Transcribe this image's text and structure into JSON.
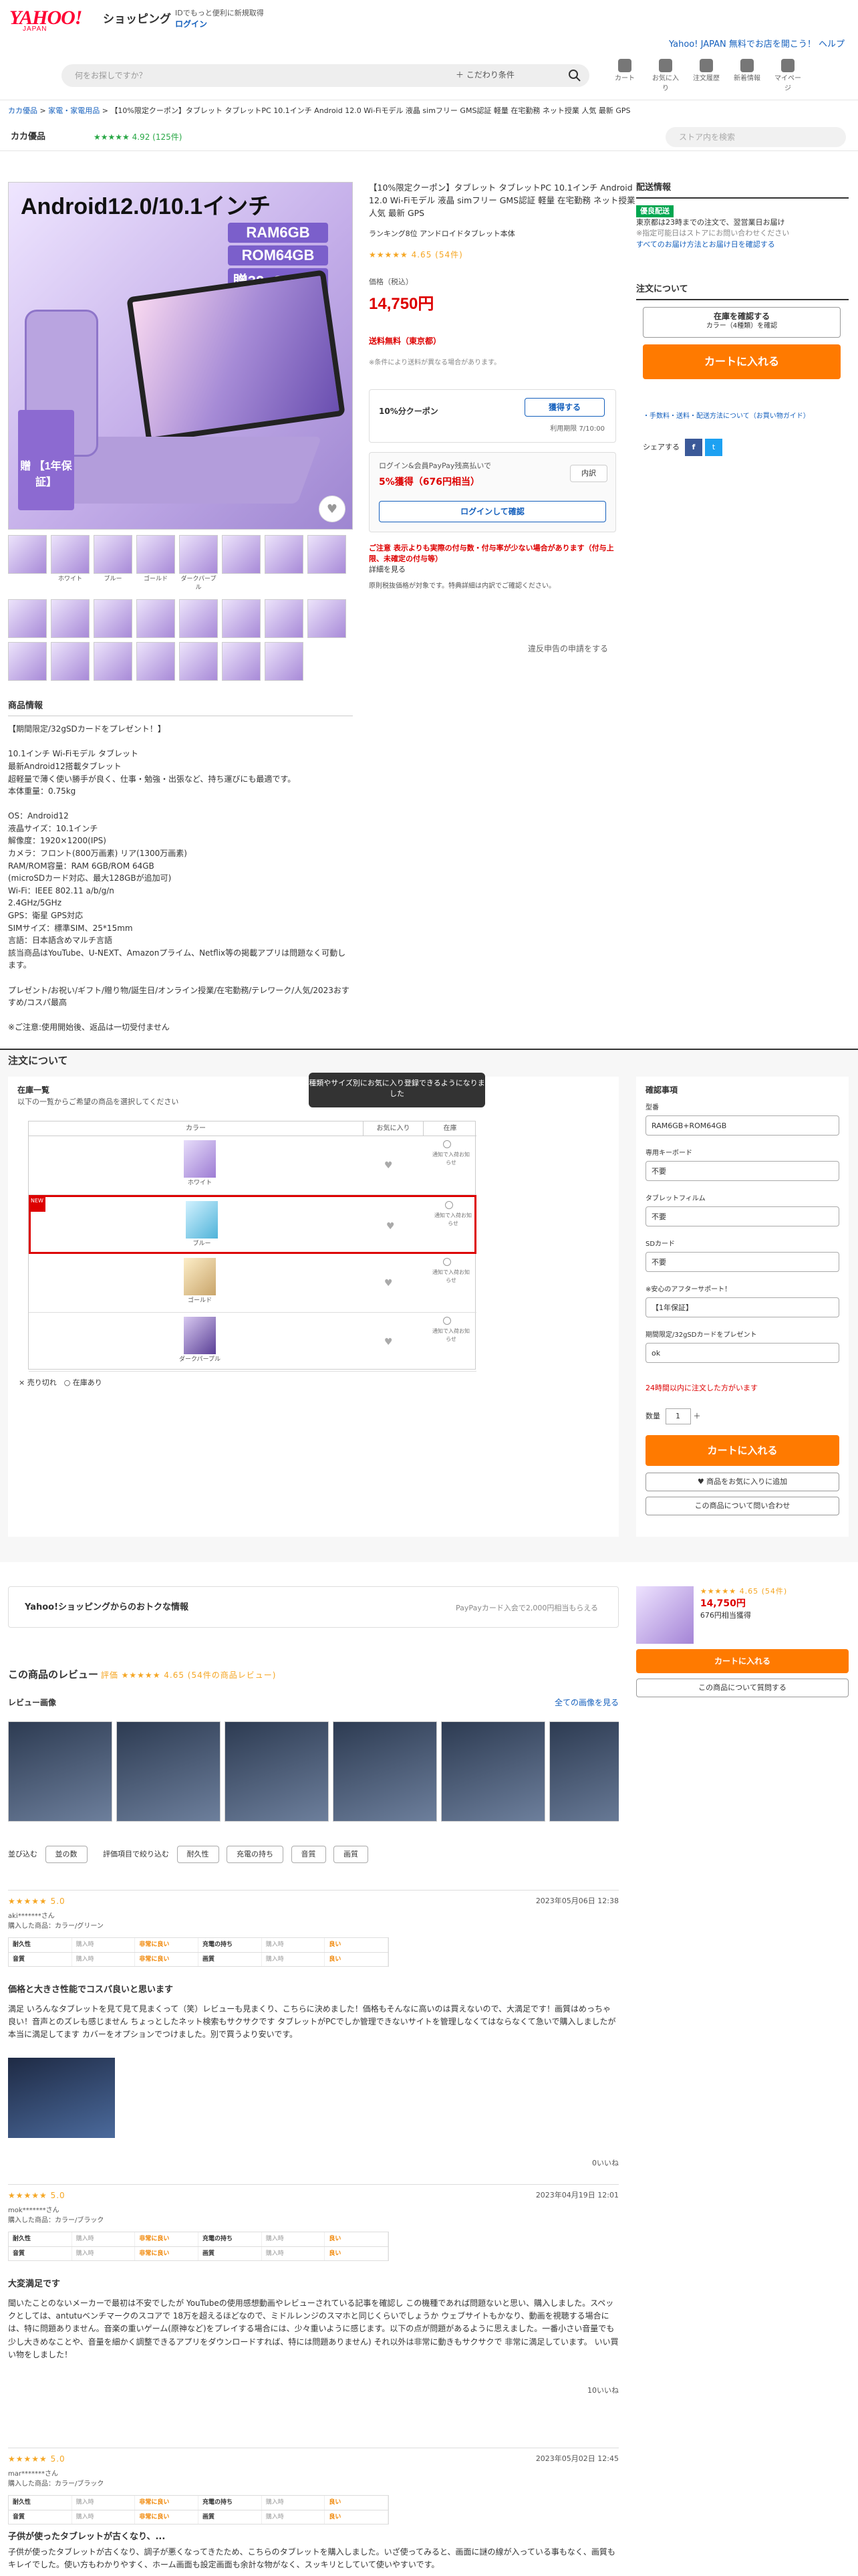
{
  "header": {
    "logo": "YAHOO!",
    "logo_sub": "JAPAN",
    "service": "ショッピング",
    "id_text": "IDでもっと便利に新規取得",
    "login": "ログイン",
    "top_link": "Yahoo! JAPAN 無料でお店を開こう！ ヘルプ",
    "search_placeholder": "何をお探しですか？",
    "cond": "＋ こだわり条件",
    "icons": [
      "カート",
      "お気に入り",
      "注文履歴",
      "新着情報",
      "マイページ"
    ]
  },
  "breadcrumb": [
    "カカ優品",
    "家電・家電用品",
    "【10%限定クーポン】タブレット タブレットPC 10.1インチ Android 12.0 Wi-Fiモデル 液晶 simフリー GMS認証 軽量 在宅勤務 ネット授業 人気 最新 GPS"
  ],
  "store": {
    "name": "カカ優品",
    "rating": "★★★★★ 4.92 (125件)",
    "search_placeholder": "ストア内を検索"
  },
  "mainimg": {
    "title": "Android12.0/10.1インチ",
    "specs": [
      "RAM6GB",
      "ROM64GB",
      "贈32gSDカード"
    ],
    "badge": "贈 【1年保証】"
  },
  "thumb_labels": [
    "ホワイト",
    "ブルー",
    "ゴールド",
    "ダークパープル"
  ],
  "report": "違反申告の申請をする",
  "product": {
    "title": "【10%限定クーポン】タブレット タブレットPC 10.1インチ Android 12.0 Wi-Fiモデル 液晶 simフリー GMS認証 軽量 在宅勤務 ネット授業 人気 最新 GPS",
    "rank": "ランキング8位 アンドロイドタブレット本体",
    "rating": "★★★★★ 4.65 (54件)",
    "price_label": "価格（税込）",
    "price": "14,750円",
    "ship": "送料無料（東京都）",
    "ship_note": "※条件により送料が異なる場合があります。",
    "coupon": "10%分クーポン",
    "coupon_btn": "獲得する",
    "coupon_exp": "利用期限 7/10:00",
    "pp_line1": "ログイン&会員PayPay残高払いで",
    "pp_line2": "5%獲得（676円相当）",
    "pp_detail": "内訳",
    "pp_btn": "ログインして確認",
    "caution": "ご注意 表示よりも実際の付与数・付与率が少ない場合があります（付与上限、未確定の付与等）",
    "caution_link": "詳細を見る",
    "caution_note": "原則税抜価格が対象です。特典詳細は内訳でご確認ください。"
  },
  "delivery": {
    "header": "配送情報",
    "badge": "優良配送",
    "line1": "東京都は23時までの注文で、翌営業日お届け",
    "line2": "※指定可能日はストアにお問い合わせください",
    "line3": "すべてのお届け方法とお届け日を確認する"
  },
  "order_box": {
    "header": "注文について",
    "check_btn": "在庫を確認する",
    "check_sub": "カラー（4種類）を確認",
    "cart": "カートに入れる",
    "links": "・手数料・送料・配送方法について（お買い物ガイド）",
    "share": "シェアする"
  },
  "desc": {
    "header": "商品情報",
    "lines": [
      "【期間限定/32gSDカードをプレゼント！】",
      "",
      "10.1インチ Wi-Fiモデル タブレット",
      "最新Android12搭載タブレット",
      "超軽量で薄く使い勝手が良く、仕事・勉強・出張など、持ち運びにも最適です。",
      "本体重量：0.75kg",
      "",
      "OS：Android12",
      "液晶サイズ：10.1インチ",
      "解像度：1920×1200(IPS)",
      "カメラ：フロント(800万画素) リア(1300万画素)",
      "RAM/ROM容量：RAM 6GB/ROM 64GB",
      "(microSDカード対応、最大128GBが追加可)",
      "Wi-Fi：IEEE 802.11 a/b/g/n",
      "2.4GHz/5GHz",
      "GPS：衛星 GPS対応",
      "SIMサイズ：標準SIM、25*15mm",
      "言語：日本語含めマルチ言語",
      "該当商品はYouTube、U-NEXT、Amazonプライム、Netflix等の掲載アプリは問題なく可動します。",
      "",
      "プレゼント/お祝い/ギフト/贈り物/誕生日/オンライン授業/在宅勤務/テレワーク/人気/2023おすすめ/コスパ最高",
      "",
      "※ご注意:使用開始後、返品は一切受付ません"
    ]
  },
  "order": {
    "header": "注文について",
    "stock_title": "在庫一覧",
    "stock_sub": "以下の一覧からご希望の商品を選択してください",
    "cols": [
      "カラー",
      "お気に入り",
      "在庫"
    ],
    "colors": [
      "ホワイト",
      "ブルー",
      "ゴールド",
      "ダークパープル"
    ],
    "stock_note": "通知で入荷お知らせ",
    "legend": "× 売り切れ　○ 在庫あり",
    "tooltip": "種類やサイズ別にお気に入り登録できるようになりました",
    "confirm": "確認事項",
    "fields": [
      {
        "label": "型番",
        "value": "RAM6GB+ROM64GB"
      },
      {
        "label": "専用キーボード",
        "value": "不要"
      },
      {
        "label": "タブレットフィルム",
        "value": "不要"
      },
      {
        "label": "SDカード",
        "value": "不要"
      },
      {
        "label": "※安心のアフターサポート！",
        "value": "【1年保証】"
      },
      {
        "label": "期間限定/32gSDカードをプレゼント",
        "value": "ok"
      }
    ],
    "warn": "24時間以内に注文した方がいます",
    "qty_label": "数量",
    "qty": "1",
    "cart": "カートに入れる",
    "fav": "♥ 商品をお気に入りに追加",
    "ask": "この商品について問い合わせ"
  },
  "deal": {
    "title": "Yahoo!ショッピングからのおトクな情報",
    "right": "PayPayカード入会で2,000円相当もらえる"
  },
  "side": {
    "rating": "★★★★★ 4.65 (54件)",
    "price": "14,750円",
    "ptext": "676円相当獲得",
    "cart": "カートに入れる",
    "ask": "この商品について質問する"
  },
  "reviews": {
    "header": "この商品のレビュー",
    "summary": "評価 ★★★★★ 4.65 (54件の商品レビュー)",
    "img_header": "レビュー画像",
    "all_link": "全ての画像を見る",
    "sort_label": "並び込む",
    "sort_value": "並の数",
    "filter_label": "評価項目で絞り込む",
    "filters": [
      "耐久性",
      "充電の持ち",
      "音質",
      "画質"
    ],
    "items": [
      {
        "score": "★★★★★ 5.0",
        "date": "2023年05月06日 12:38",
        "user": "aki*******さん",
        "buy": "購入した商品：カラー/グリーン",
        "title": "価格と大きさ性能でコスパ良いと思います",
        "body": "満足 いろんなタブレットを見て見て見まくって（笑）レビューも見まくり、こちらに決めました！価格もそんなに高いのは買えないので、大満足です！画質はめっちゃ良い！音声とのズレも感じません ちょっとしたネット検索もサクサクです タブレットがPCでしか管理できないサイトを管理しなくてはならなくて急いで購入しましたが本当に満足してます カバーをオプションでつけました。別で買うより安いです。",
        "like": "0いいね"
      },
      {
        "score": "★★★★★ 5.0",
        "date": "2023年04月19日 12:01",
        "user": "mok*******さん",
        "buy": "購入した商品：カラー/ブラック",
        "title": "大変満足です",
        "body": "聞いたことのないメーカーで最初は不安でしたが YouTubeの使用感想動画やレビューされている記事を確認し この機種であれば問題ないと思い、購入しました。スペックとしては、antutuベンチマークのスコアで 18万を超えるほどなので、ミドルレンジのスマホと同じくらいでしょうか ウェブサイトもかなり、動画を視聴する場合には、特に問題ありません。音楽の重いゲーム(原神など)をプレイする場合には、少々重いように感じます。以下の点が問題があるように思えました。一番小さい音量でも少し大きめなことや、音量を細かく調整できるアプリをダウンロードすれば、特には問題ありません) それ以外は非常に動きもサクサクで 非常に満足しています。 いい買い物をしました！",
        "like": "10いいね"
      },
      {
        "score": "★★★★★ 5.0",
        "date": "2023年05月02日 12:45",
        "user": "mar*******さん",
        "buy": "購入した商品：カラー/ブラック",
        "title": "子供が使ったタブレットが古くなり、...",
        "body": "子供が使ったタブレットが古くなり、調子が悪くなってきたため、こちらのタブレットを購入しました。いざ使ってみると、画面に謎の線が入っている事もなく、画質もキレイでした。使い方もわかりやすく、ホーム画面も設定画面も余計な物がなく、スッキリとしていて使いやすいです。",
        "like": "0いいね"
      }
    ]
  },
  "review_metrics": [
    [
      "耐久性",
      "購入時",
      "非常に良い"
    ],
    [
      "充電の持ち",
      "購入時",
      "良い"
    ],
    [
      "音質",
      "購入時",
      "非常に良い"
    ],
    [
      "画質",
      "購入時",
      "良い"
    ]
  ]
}
